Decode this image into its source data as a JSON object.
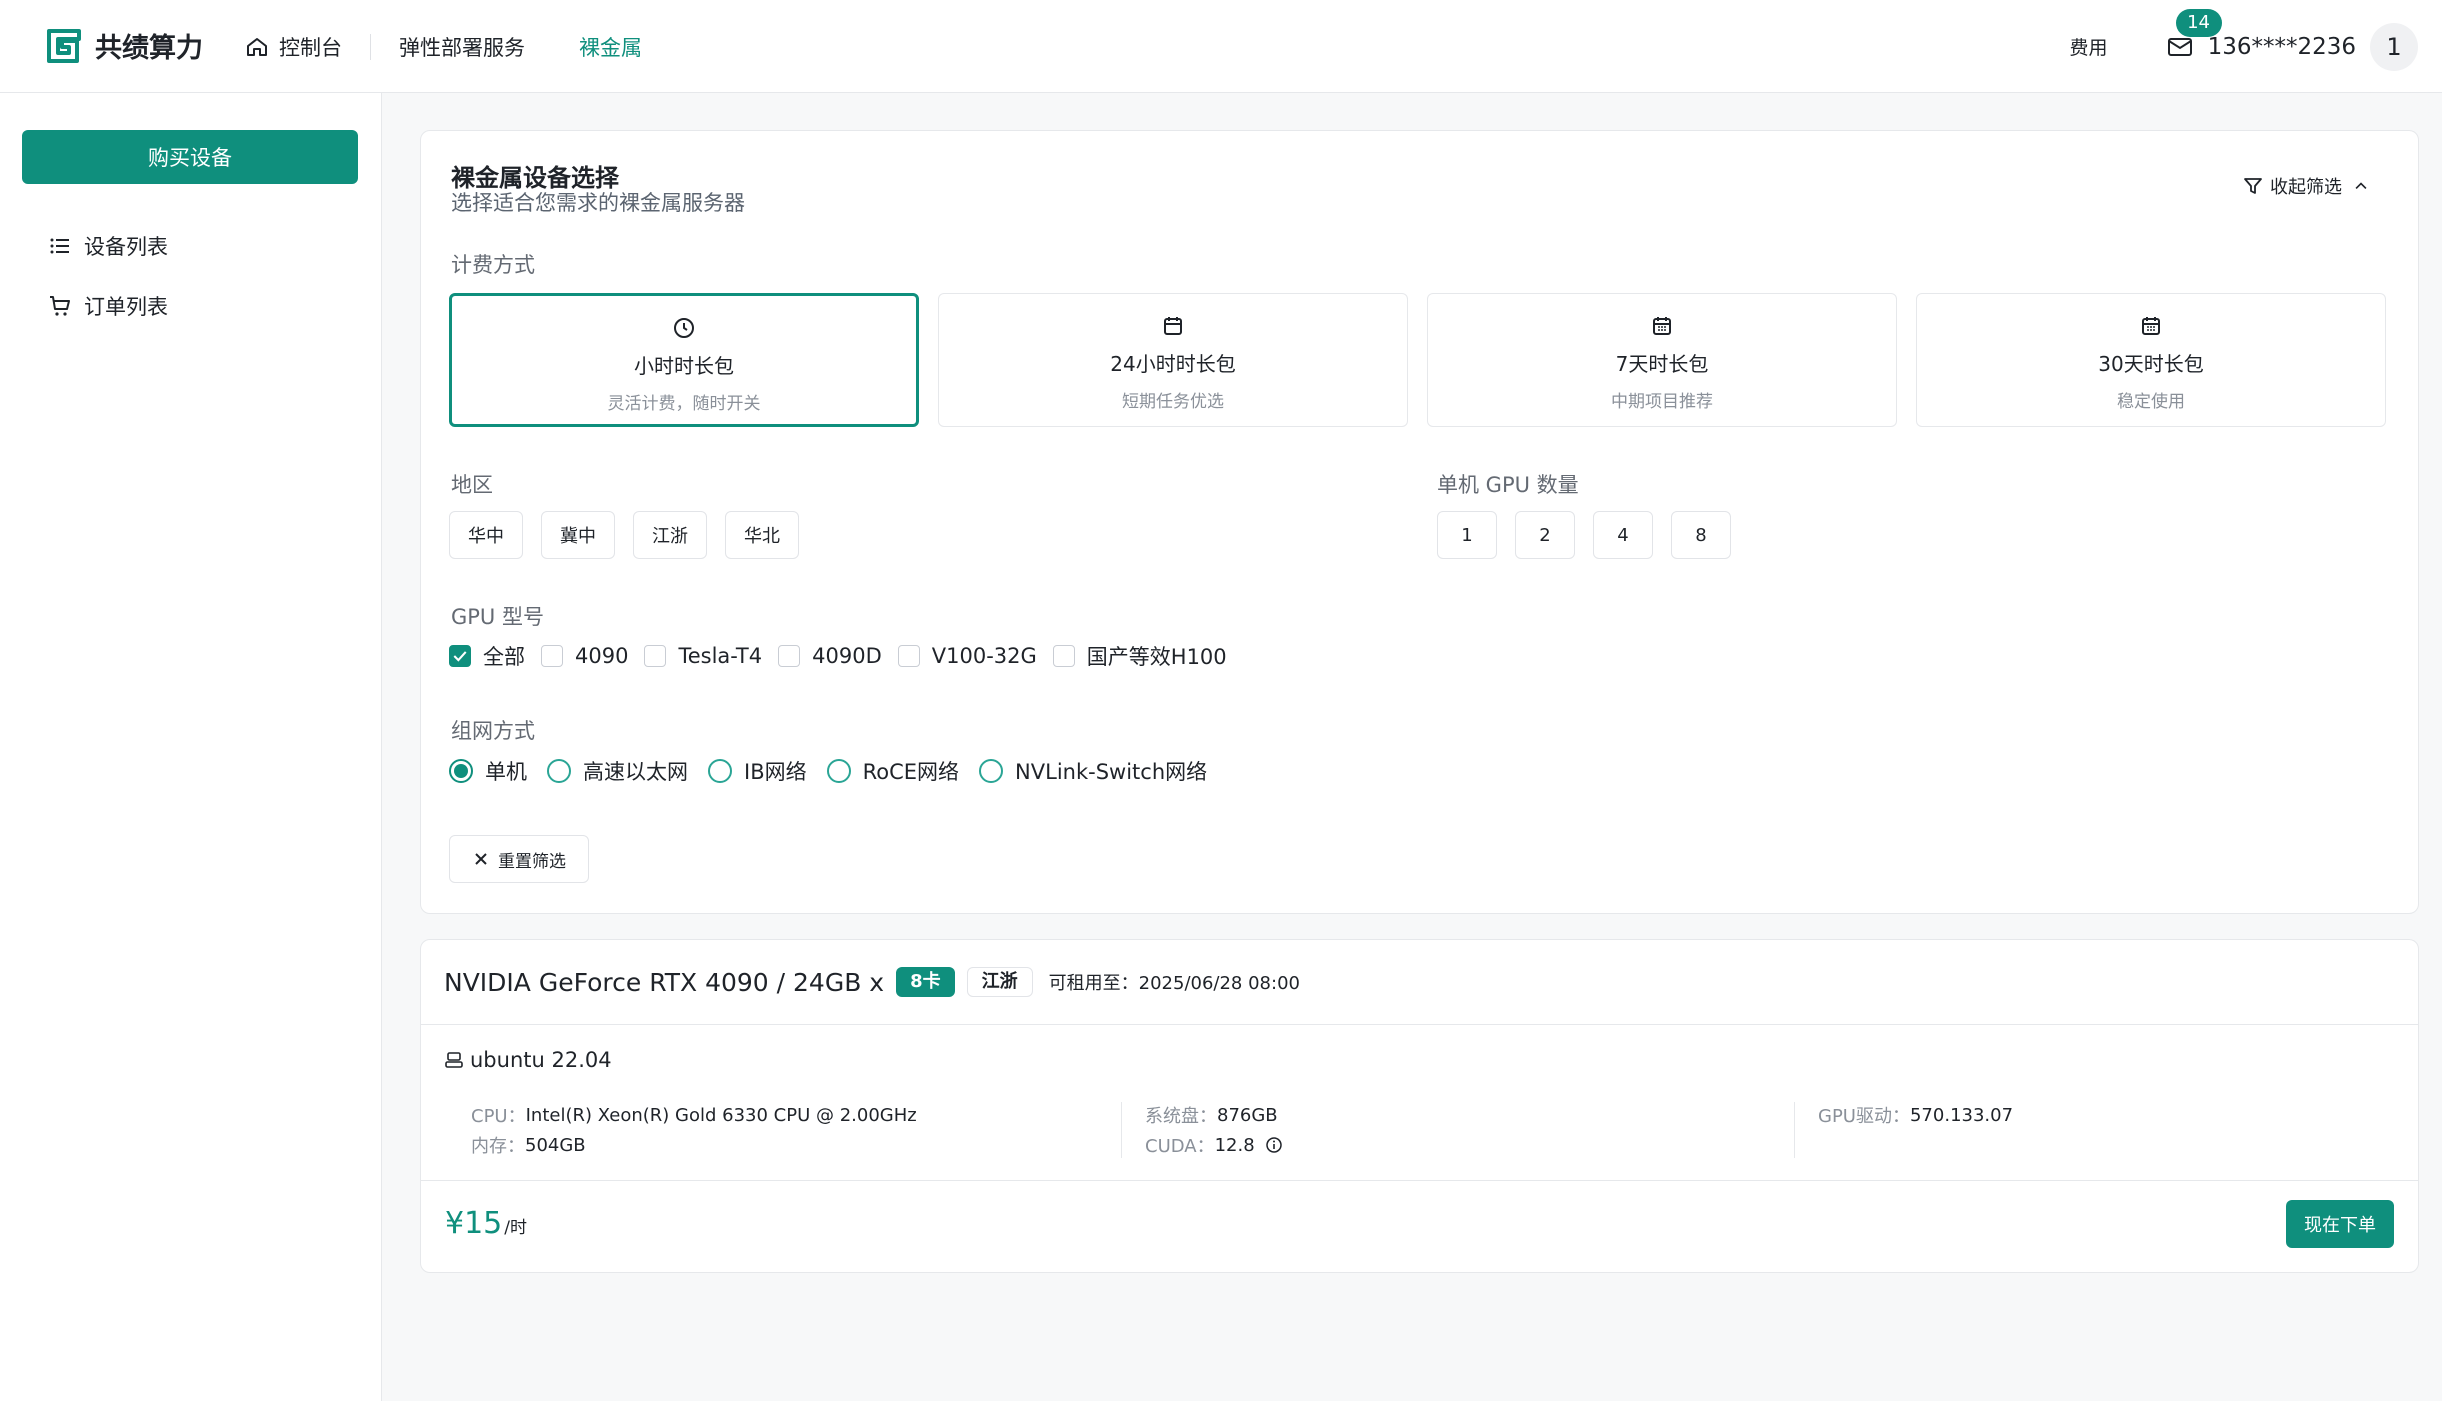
{
  "app": {
    "brand": "共绩算力"
  },
  "nav": {
    "console": "控制台",
    "elastic": "弹性部署服务",
    "baremetal": "裸金属"
  },
  "topbar": {
    "fee": "费用",
    "mail_badge": "14",
    "phone": "136****2236",
    "avatar_initial": "1"
  },
  "sidebar": {
    "buy_label": "购买设备",
    "device_list": "设备列表",
    "order_list": "订单列表"
  },
  "filter": {
    "title": "裸金属设备选择",
    "subtitle": "选择适合您需求的裸金属服务器",
    "collapse_label": "收起筛选",
    "billing_label": "计费方式",
    "billing_options": [
      {
        "title": "小时时长包",
        "sub": "灵活计费，随时开关",
        "icon": "clock-icon",
        "active": true
      },
      {
        "title": "24小时时长包",
        "sub": "短期任务优选",
        "icon": "calendar-icon",
        "active": false
      },
      {
        "title": "7天时长包",
        "sub": "中期项目推荐",
        "icon": "calendar-grid-icon",
        "active": false
      },
      {
        "title": "30天时长包",
        "sub": "稳定使用",
        "icon": "calendar-grid-icon",
        "active": false
      }
    ],
    "region_label": "地区",
    "regions": [
      "华中",
      "冀中",
      "江浙",
      "华北"
    ],
    "gpu_count_label": "单机 GPU 数量",
    "gpu_counts": [
      "1",
      "2",
      "4",
      "8"
    ],
    "gpu_model_label": "GPU 型号",
    "gpu_models": [
      {
        "label": "全部",
        "checked": true
      },
      {
        "label": "4090",
        "checked": false
      },
      {
        "label": "Tesla-T4",
        "checked": false
      },
      {
        "label": "4090D",
        "checked": false
      },
      {
        "label": "V100-32G",
        "checked": false
      },
      {
        "label": "国产等效H100",
        "checked": false
      }
    ],
    "network_label": "组网方式",
    "networks": [
      {
        "label": "单机",
        "checked": true
      },
      {
        "label": "高速以太网",
        "checked": false
      },
      {
        "label": "IB网络",
        "checked": false
      },
      {
        "label": "RoCE网络",
        "checked": false
      },
      {
        "label": "NVLink-Switch网络",
        "checked": false
      }
    ],
    "reset_label": "重置筛选"
  },
  "device": {
    "name": "NVIDIA GeForce RTX 4090 / 24GB x",
    "badge": "8卡",
    "region": "江浙",
    "available": "可租用至：2025/06/28 08:00",
    "os": "ubuntu 22.04",
    "cpu_k": "CPU：",
    "cpu_v": "Intel(R) Xeon(R) Gold 6330 CPU @ 2.00GHz",
    "mem_k": "内存：",
    "mem_v": "504GB",
    "disk_k": "系统盘：",
    "disk_v": "876GB",
    "cuda_k": "CUDA：",
    "cuda_v": "12.8",
    "driver_k": "GPU驱动：",
    "driver_v": "570.133.07",
    "price": "¥15",
    "price_unit": "/时",
    "order_label": "现在下单"
  },
  "colors": {
    "accent": "#0f8f7d"
  }
}
